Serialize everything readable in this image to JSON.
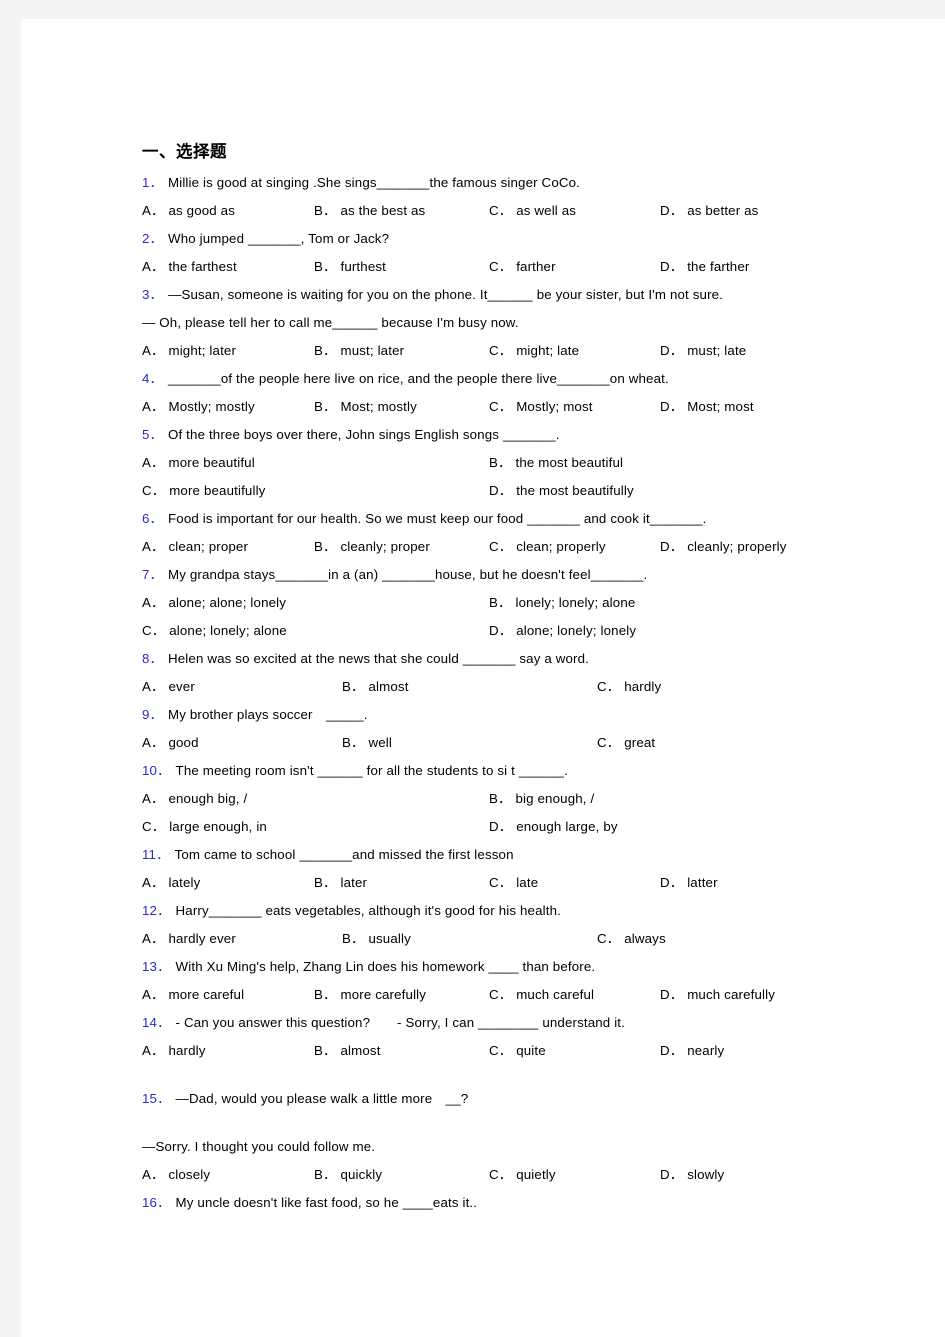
{
  "document": {
    "section_heading": "一、选择题",
    "questions": [
      {
        "num": "1．",
        "stem": "Millie is good at singing .She sings_______the famous singer CoCo.",
        "layout": "four",
        "options": [
          {
            "label": "A．",
            "text": "as good as"
          },
          {
            "label": "B．",
            "text": "as the best as"
          },
          {
            "label": "C．",
            "text": "as well as"
          },
          {
            "label": "D．",
            "text": "as better as"
          }
        ]
      },
      {
        "num": "2．",
        "stem": "Who jumped _______, Tom or Jack?",
        "layout": "four",
        "options": [
          {
            "label": "A．",
            "text": "the farthest"
          },
          {
            "label": "B．",
            "text": "furthest"
          },
          {
            "label": "C．",
            "text": "farther"
          },
          {
            "label": "D．",
            "text": "the farther"
          }
        ]
      },
      {
        "num": "3．",
        "stem": "—Susan, someone is waiting for you on the phone. It______ be your sister, but I'm not sure.",
        "continuation": "— Oh, please tell her to call me______ because I'm busy now.",
        "layout": "four",
        "options": [
          {
            "label": "A．",
            "text": "might; later"
          },
          {
            "label": "B．",
            "text": "must; later"
          },
          {
            "label": "C．",
            "text": "might; late"
          },
          {
            "label": "D．",
            "text": "must; late"
          }
        ]
      },
      {
        "num": "4．",
        "stem": "_______of the people here live on rice, and the people there live_______on wheat.",
        "layout": "four",
        "options": [
          {
            "label": "A．",
            "text": "Mostly; mostly"
          },
          {
            "label": "B．",
            "text": "Most; mostly"
          },
          {
            "label": "C．",
            "text": "Mostly; most"
          },
          {
            "label": "D．",
            "text": "Most; most"
          }
        ]
      },
      {
        "num": "5．",
        "stem": "Of the three boys over there, John sings English songs _______.",
        "layout": "two",
        "options": [
          {
            "label": "A．",
            "text": "more beautiful"
          },
          {
            "label": "B．",
            "text": "the most beautiful"
          },
          {
            "label": "C．",
            "text": "more beautifully"
          },
          {
            "label": "D．",
            "text": "the most beautifully"
          }
        ]
      },
      {
        "num": "6．",
        "stem": "Food is important for our health. So we must keep our food _______ and cook it_______.",
        "layout": "four",
        "options": [
          {
            "label": "A．",
            "text": "clean; proper"
          },
          {
            "label": "B．",
            "text": "cleanly; proper"
          },
          {
            "label": "C．",
            "text": "clean; properly"
          },
          {
            "label": "D．",
            "text": "cleanly; properly"
          }
        ]
      },
      {
        "num": "7．",
        "stem": "My grandpa stays_______in a (an) _______house, but he doesn't feel_______.",
        "layout": "two",
        "options": [
          {
            "label": "A．",
            "text": "alone; alone; lonely"
          },
          {
            "label": "B．",
            "text": "lonely; lonely; alone"
          },
          {
            "label": "C．",
            "text": "alone; lonely; alone"
          },
          {
            "label": "D．",
            "text": "alone; lonely; lonely"
          }
        ]
      },
      {
        "num": "8．",
        "stem": "Helen was so excited at the news that she could _______ say a word.",
        "layout": "three",
        "options": [
          {
            "label": "A．",
            "text": "ever"
          },
          {
            "label": "B．",
            "text": "almost"
          },
          {
            "label": "C．",
            "text": "hardly"
          }
        ]
      },
      {
        "num": "9．",
        "stem": "My brother plays soccer　_____.",
        "layout": "three",
        "options": [
          {
            "label": "A．",
            "text": "good"
          },
          {
            "label": "B．",
            "text": "well"
          },
          {
            "label": "C．",
            "text": "great"
          }
        ]
      },
      {
        "num": "10．",
        "stem": "The meeting room isn't ______ for all the students to si t ______.",
        "layout": "two",
        "options": [
          {
            "label": "A．",
            "text": "enough big, /"
          },
          {
            "label": "B．",
            "text": "big enough, /"
          },
          {
            "label": "C．",
            "text": "large enough, in"
          },
          {
            "label": "D．",
            "text": "enough large, by"
          }
        ]
      },
      {
        "num": "11．",
        "stem": "Tom came to school _______and missed the first lesson",
        "layout": "four",
        "options": [
          {
            "label": "A．",
            "text": "lately"
          },
          {
            "label": "B．",
            "text": "later"
          },
          {
            "label": "C．",
            "text": "late"
          },
          {
            "label": "D．",
            "text": "latter"
          }
        ]
      },
      {
        "num": "12．",
        "stem": "Harry_______ eats vegetables, although it's good for his health.",
        "layout": "three",
        "options": [
          {
            "label": "A．",
            "text": "hardly ever"
          },
          {
            "label": "B．",
            "text": "usually"
          },
          {
            "label": "C．",
            "text": "always"
          }
        ]
      },
      {
        "num": "13．",
        "stem": "With Xu Ming's help, Zhang Lin does his homework ____ than before.",
        "layout": "four",
        "options": [
          {
            "label": "A．",
            "text": "more careful"
          },
          {
            "label": "B．",
            "text": "more carefully"
          },
          {
            "label": "C．",
            "text": "much careful"
          },
          {
            "label": "D．",
            "text": "much carefully"
          }
        ]
      },
      {
        "num": "14．",
        "stem": "- Can you answer this question?　　- Sorry, I can ________ understand it.",
        "layout": "four",
        "options": [
          {
            "label": "A．",
            "text": "hardly"
          },
          {
            "label": "B．",
            "text": "almost"
          },
          {
            "label": "C．",
            "text": "quite"
          },
          {
            "label": "D．",
            "text": "nearly"
          }
        ]
      },
      {
        "num": "15．",
        "stem": "—Dad, would you please walk a little more　__?",
        "continuation": "—Sorry. I thought you could follow me.",
        "gap_before": true,
        "gap_in_continuation": true,
        "layout": "four",
        "options": [
          {
            "label": "A．",
            "text": "closely"
          },
          {
            "label": "B．",
            "text": "quickly"
          },
          {
            "label": "C．",
            "text": "quietly"
          },
          {
            "label": "D．",
            "text": "slowly"
          }
        ]
      },
      {
        "num": "16．",
        "stem": "My uncle doesn't like fast food, so he ____eats it..",
        "layout": "none",
        "options": []
      }
    ]
  },
  "colors": {
    "question_number": "#2a2ad0",
    "text": "#000000",
    "page_background": "#ffffff",
    "frame_background": "#f4f4f4"
  }
}
